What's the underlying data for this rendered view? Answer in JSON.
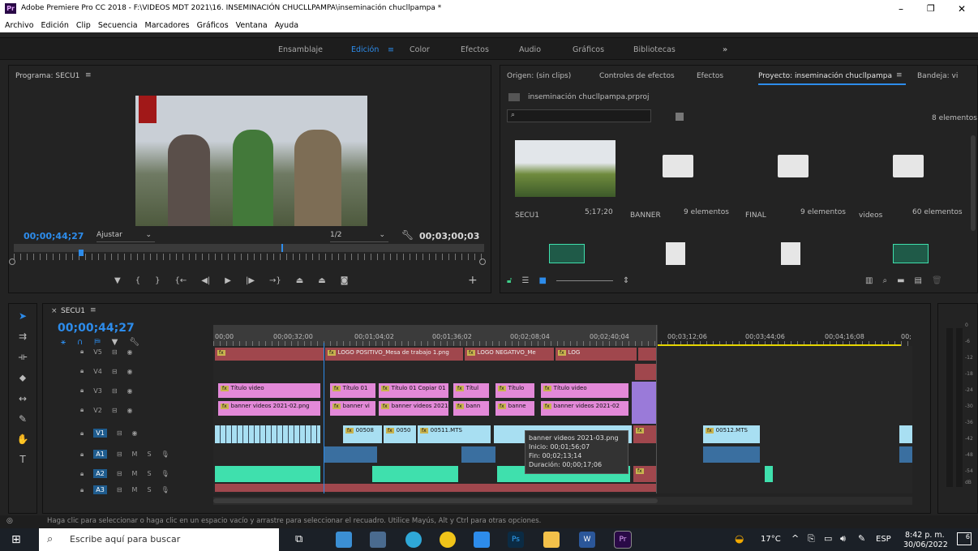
{
  "window": {
    "title": "Adobe Premiere Pro CC 2018 - F:\\VIDEOS MDT 2021\\16. INSEMINACIÓN CHUCLLPAMPA\\inseminación chucllpampa *",
    "app_icon": "Pr",
    "min": "–",
    "max": "❐",
    "close": "✕"
  },
  "menu": [
    "Archivo",
    "Edición",
    "Clip",
    "Secuencia",
    "Marcadores",
    "Gráficos",
    "Ventana",
    "Ayuda"
  ],
  "workspaces": {
    "ensamblaje": "Ensamblaje",
    "edicion": "Edición",
    "color": "Color",
    "efectos": "Efectos",
    "audio": "Audio",
    "graficos": "Gráficos",
    "bibliotecas": "Bibliotecas",
    "more": "»",
    "menu_icon": "≡"
  },
  "program": {
    "title": "Programa: SECU1",
    "menu_icon": "≡",
    "timecode": "00;00;44;27",
    "fit": "Ajustar",
    "resolution": "1/2",
    "duration": "00;03;00;03"
  },
  "source_tabs": {
    "origen": "Origen: (sin clips)",
    "controles": "Controles de efectos",
    "efectos": "Efectos",
    "proyecto": "Proyecto: inseminación chucllpampa",
    "menu_icon": "≡",
    "bandeja": "Bandeja: vi"
  },
  "project": {
    "file": "inseminación chucllpampa.prproj",
    "search_placeholder": "",
    "count": "8 elementos",
    "items": [
      {
        "name": "SECU1",
        "meta": "5;17;20"
      },
      {
        "name": "BANNER",
        "meta": "9 elementos"
      },
      {
        "name": "FINAL",
        "meta": "9 elementos"
      },
      {
        "name": "videos",
        "meta": "60 elementos"
      }
    ]
  },
  "timeline": {
    "tab": "SECU1",
    "menu_icon": "≡",
    "close": "×",
    "timecode": "00;00;44;27",
    "ruler": [
      "00;00",
      "00;00;32;00",
      "00;01;04;02",
      "00;01;36;02",
      "00;02;08;04",
      "00;02;40;04",
      "00;03;12;06",
      "00;03;44;06",
      "00;04;16;08",
      "00;"
    ],
    "tracks": [
      {
        "id": "V5",
        "label": "V5"
      },
      {
        "id": "V4",
        "label": "V4"
      },
      {
        "id": "V3",
        "label": "V3"
      },
      {
        "id": "V2",
        "label": "V2"
      },
      {
        "id": "V1",
        "label": "V1"
      },
      {
        "id": "A1",
        "label": "A1"
      },
      {
        "id": "A2",
        "label": "A2"
      },
      {
        "id": "A3",
        "label": "A3"
      }
    ],
    "clips": {
      "v5a": "LOGO POSITIVO_Mesa de trabajo 1.png",
      "v5b": "LOGO NEGATIVO_Me",
      "v5c": "LOG",
      "v3a": "Título video",
      "v3b": "Título 01",
      "v3c": "Título 01 Copiar 01",
      "v3d": "Títul",
      "v3e": "Título",
      "v3f": "Título video",
      "v2a": "banner videos 2021-02.png",
      "v2b": "banner vi",
      "v2c": "banner videos 2021-0",
      "v2d": "bann",
      "v2e": "banne",
      "v2f": "banner videos 2021-02",
      "v1a": "00508",
      "v1b": "0050",
      "v1c": "00511.MTS",
      "v1d": "00512.MTS",
      "fx": "fx"
    },
    "tooltip": {
      "name": "banner videos 2021-03.png",
      "start": "Inicio: 00;01;56;07",
      "end": "Fin: 00;02;13;14",
      "dur": "Duración: 00;00;17;06"
    }
  },
  "meter": {
    "ticks": [
      "0",
      "-6",
      "-12",
      "-18",
      "-24",
      "-30",
      "-36",
      "-42",
      "-48",
      "-54",
      "dB"
    ]
  },
  "status": "Haga clic para seleccionar o haga clic en un espacio vacío y arrastre para seleccionar el recuadro. Utilice Mayús, Alt y Ctrl para otras opciones.",
  "taskbar": {
    "search_placeholder": "Escribe aquí para buscar",
    "weather": "17°C",
    "lang": "ESP",
    "time": "8:42 p. m.",
    "date": "30/06/2022",
    "notif": "6",
    "ps": "Ps",
    "pr": "Pr",
    "word": "W"
  },
  "colors": {
    "accent": "#2d8ceb",
    "v_pink": "#e389d8",
    "v_teal": "#a8dff2",
    "a_green": "#3fe0ad",
    "red_clip": "#a0474d"
  }
}
